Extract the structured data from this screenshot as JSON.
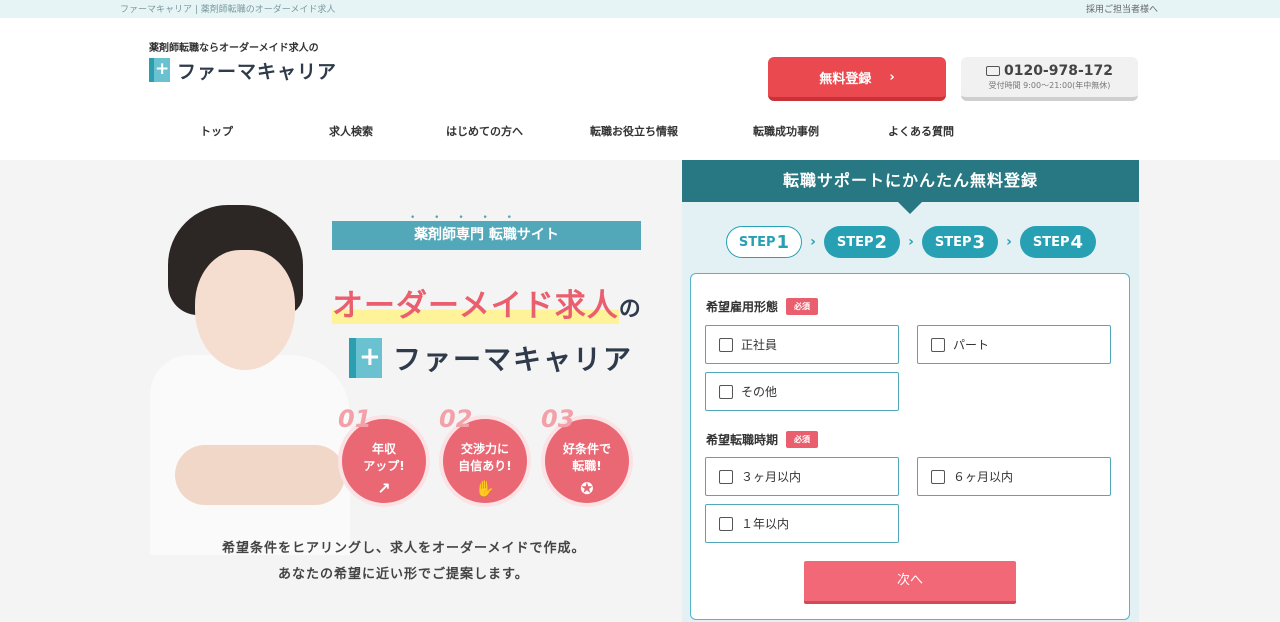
{
  "topbar": {
    "site_description": "ファーマキャリア | 薬剤師転職のオーダーメイド求人",
    "recruit_link": "採用ご担当者様へ"
  },
  "header": {
    "tagline": "薬剤師転職ならオーダーメイド求人の",
    "logo_text": "ファーマキャリア",
    "register_label": "無料登録",
    "register_chevron": "›",
    "phone_number": "0120-978-172",
    "phone_hours": "受付時間 9:00〜21:00(年中無休)"
  },
  "nav": {
    "items": [
      {
        "label": "トップ"
      },
      {
        "label": "求人検索"
      },
      {
        "label": "はじめての方へ"
      },
      {
        "label": "転職お役立ち情報"
      },
      {
        "label": "転職成功事例"
      },
      {
        "label": "よくある質問"
      }
    ]
  },
  "hero": {
    "ribbon": "薬剤師専門 転職サイト",
    "dots": "• • • • •",
    "headline": "オーダーメイド求人",
    "headline_suffix": "の",
    "brand": "ファーマキャリア",
    "badges": [
      {
        "num": "01",
        "line1": "年収",
        "line2": "アップ!",
        "icon": "↗"
      },
      {
        "num": "02",
        "line1": "交渉力に",
        "line2": "自信あり!",
        "icon": "✋"
      },
      {
        "num": "03",
        "line1": "好条件で",
        "line2": "転職!",
        "icon": "✪"
      }
    ],
    "sub1": "希望条件をヒアリングし、求人をオーダーメイドで作成。",
    "sub2": "あなたの希望に近い形でご提案します。"
  },
  "form": {
    "title": "転職サポートにかんたん無料登録",
    "steps": [
      {
        "label": "STEP",
        "num": "1"
      },
      {
        "label": "STEP",
        "num": "2"
      },
      {
        "label": "STEP",
        "num": "3"
      },
      {
        "label": "STEP",
        "num": "4"
      }
    ],
    "step_arrow": "›",
    "q1": {
      "label": "希望雇用形態",
      "required": "必須",
      "options": [
        "正社員",
        "パート",
        "その他"
      ]
    },
    "q2": {
      "label": "希望転職時期",
      "required": "必須",
      "options": [
        "３ヶ月以内",
        "６ヶ月以内",
        "１年以内"
      ]
    },
    "next_label": "次へ"
  },
  "colors": {
    "accent_red": "#ea4a4f",
    "teal": "#277882",
    "teal_light": "#27a0b3",
    "pink": "#f26877"
  }
}
